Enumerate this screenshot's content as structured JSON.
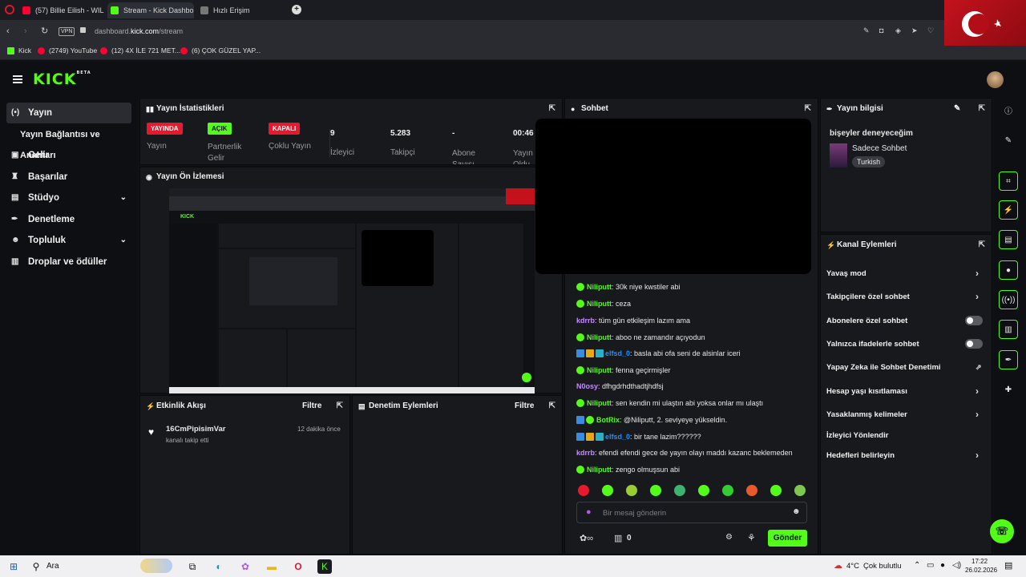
{
  "browser": {
    "tabs": [
      {
        "label": "(57) Billie Eilish - WILDFLO",
        "icon": "youtube-icon",
        "color": "#ff0033"
      },
      {
        "label": "Stream - Kick Dashbo",
        "icon": "kick-icon",
        "color": "#53fc18"
      },
      {
        "label": "Hızlı Erişim",
        "icon": "grid-icon",
        "color": "#888888"
      }
    ],
    "new_tab": "+",
    "vpn": "VPN",
    "url_prefix": "dashboard.",
    "url_domain": "kick.com",
    "url_path": "/stream",
    "bookmarks": [
      {
        "label": "Kick",
        "color": "#53fc18"
      },
      {
        "label": "(2749) YouTube",
        "color": "#ff0033"
      },
      {
        "label": "(12) 4X İLE 721 MET...",
        "color": "#ff0033"
      },
      {
        "label": "(6) ÇOK GÜZEL YAP...",
        "color": "#ff0033"
      }
    ]
  },
  "kick": {
    "logo": "KICK",
    "logo_tag": "BETA",
    "accent": "#53fc18"
  },
  "nav": {
    "items": [
      {
        "label": "Yayın",
        "icon": "broadcast-icon"
      },
      {
        "label": "Yayın Bağlantısı ve Anahtarı"
      },
      {
        "label": "Gelir",
        "icon": "wallet-icon"
      },
      {
        "label": "Başarılar",
        "icon": "trophy-icon"
      },
      {
        "label": "Stüdyo",
        "icon": "studio-icon"
      },
      {
        "label": "Denetleme",
        "icon": "wrench-icon"
      },
      {
        "label": "Topluluk",
        "icon": "people-icon"
      },
      {
        "label": "Droplar ve ödüller",
        "icon": "gift-icon"
      }
    ]
  },
  "stats": {
    "title": "Yayın İstatistikleri",
    "items": [
      {
        "value": "YAYINDA",
        "label": "Yayın",
        "badge": "#e8192c"
      },
      {
        "value": "AÇIK",
        "label": "Partnerlik Gelir",
        "badge": "#53fc18"
      },
      {
        "value": "KAPALI",
        "label": "Çoklu Yayın",
        "badge": "#e8192c"
      },
      {
        "value": "9",
        "label": "İzleyici"
      },
      {
        "value": "5.283",
        "label": "Takipçi"
      },
      {
        "value": "-",
        "label": "Abone Sayısı"
      },
      {
        "value": "00:46",
        "label": "Yayın Oldu"
      }
    ]
  },
  "preview": {
    "title": "Yayın Ön İzlemesi"
  },
  "activity": {
    "title": "Etkinlik Akışı",
    "filter": "Filtre",
    "event_user": "16CmPipisimVar",
    "event_text": "kanalı takip etti",
    "event_time": "12 dakika önce"
  },
  "moderation": {
    "title": "Denetim Eylemleri",
    "filter": "Filtre"
  },
  "chat": {
    "title": "Sohbet",
    "messages": [
      {
        "user": "Niliputt",
        "color": "#53fc18",
        "text": ": 30k niye kwstiler abi",
        "badges": [
          "v"
        ]
      },
      {
        "user": "Niliputt",
        "color": "#53fc18",
        "text": ": ceza",
        "badges": [
          "v"
        ]
      },
      {
        "user": "kdrrb",
        "color": "#c58cff",
        "text": ": tüm gün etkileşim lazım ama",
        "badges": []
      },
      {
        "user": "Niliputt",
        "color": "#53fc18",
        "text": ": aboo ne zamandır açıyodun",
        "badges": [
          "v"
        ]
      },
      {
        "user": "elfsd_0",
        "color": "#1e90ff",
        "text": ": basla abi ofa seni de alsinlar iceri",
        "badges": [
          "b",
          "c",
          "s"
        ]
      },
      {
        "user": "Niliputt",
        "color": "#53fc18",
        "text": ": fenna geçirmişler",
        "badges": [
          "v"
        ]
      },
      {
        "user": "N0osy",
        "color": "#c58cff",
        "text": ": dfhgdrhdthadtjhdfsj",
        "badges": []
      },
      {
        "user": "Niliputt",
        "color": "#53fc18",
        "text": ": sen kendin mi ulaştın abi yoksa onlar mı ulaştı",
        "badges": [
          "v"
        ]
      },
      {
        "user": "BotRix",
        "color": "#53fc18",
        "text": ": @Niliputt, 2. seviyeye yükseldin.",
        "badges": [
          "b",
          "v"
        ]
      },
      {
        "user": "elfsd_0",
        "color": "#1e90ff",
        "text": ": bir tane lazim??????",
        "badges": [
          "b",
          "c",
          "s"
        ]
      },
      {
        "user": "kdrrb",
        "color": "#c58cff",
        "text": ": efendi efendi gece de yayın olayı maddı kazanc beklemeden",
        "badges": []
      },
      {
        "user": "Niliputt",
        "color": "#53fc18",
        "text": ": zengo olmuşsun abi",
        "badges": [
          "v"
        ]
      }
    ],
    "placeholder": "Bir mesaj gönderin",
    "points": "0",
    "send": "Gönder"
  },
  "info": {
    "title": "Yayın bilgisi",
    "stream_title": "bişeyler deneyeceğim",
    "category": "Sadece Sohbet",
    "language": "Turkish"
  },
  "channel_actions": {
    "title": "Kanal Eylemleri",
    "items": [
      {
        "label": "Yavaş mod",
        "control": "arrow"
      },
      {
        "label": "Takipçilere özel sohbet",
        "control": "arrow"
      },
      {
        "label": "Abonelere özel sohbet",
        "control": "toggle"
      },
      {
        "label": "Yalnızca ifadelerle sohbet",
        "control": "toggle"
      },
      {
        "label": "Yapay Zeka ile Sohbet Denetimi",
        "control": "external"
      },
      {
        "label": "Hesap yaşı kısıtlaması",
        "control": "arrow"
      },
      {
        "label": "Yasaklanmış kelimeler",
        "control": "arrow"
      },
      {
        "label": "İzleyici Yönlendir",
        "control": "none"
      },
      {
        "label": "Hedefleri belirleyin",
        "control": "arrow"
      }
    ]
  },
  "taskbar": {
    "search": "Ara",
    "weather": "4°C",
    "weather_text": "Çok bulutlu",
    "time": "17:22",
    "date": "26.02.2026"
  }
}
